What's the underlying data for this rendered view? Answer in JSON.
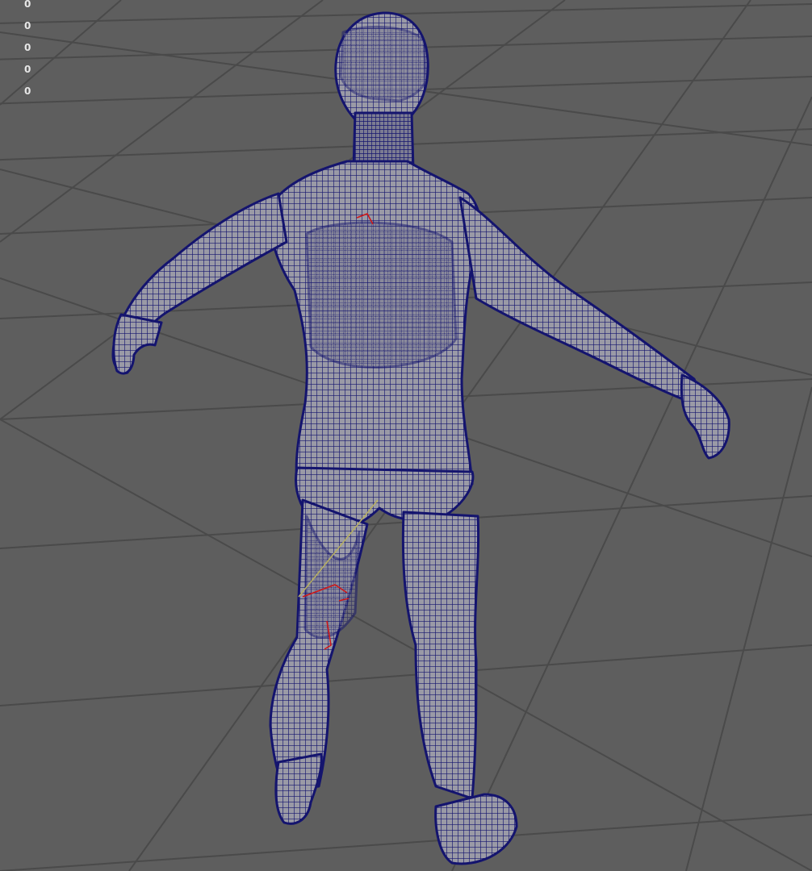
{
  "viewport": {
    "background": "#5e5e5e",
    "grid_color": "#4a4a4a",
    "mesh_fill": "#9a9aa6",
    "wire_color": "#14146e",
    "highlight_color": "#d01818",
    "joint_color": "#b8b060"
  },
  "hud": {
    "stats": [
      "0",
      "0",
      "0",
      "0",
      "0"
    ]
  },
  "model": {
    "name_icon": "wireframe-character-mesh"
  }
}
